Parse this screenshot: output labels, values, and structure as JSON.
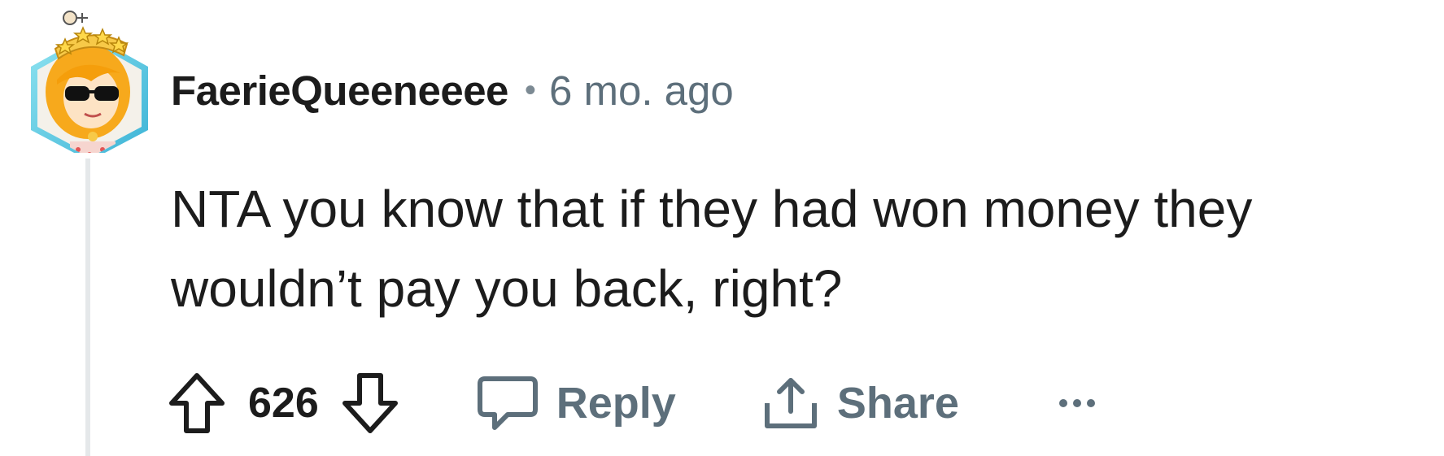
{
  "comment": {
    "username": "FaerieQueeneeee",
    "separator": "•",
    "timestamp": "6 mo. ago",
    "body": "NTA you know that if they had won money they wouldn’t pay you back, right?"
  },
  "actions": {
    "vote_count": "626",
    "reply_label": "Reply",
    "share_label": "Share"
  },
  "icons": {
    "upvote": "upvote-icon",
    "downvote": "downvote-icon",
    "reply": "comment-bubble-icon",
    "share": "share-icon",
    "more": "more-options-icon"
  },
  "colors": {
    "text_primary": "#1c1c1c",
    "text_secondary": "#5d6f7b",
    "thread_line": "#e5e8ea",
    "avatar_frame": "#6fd6e8"
  }
}
